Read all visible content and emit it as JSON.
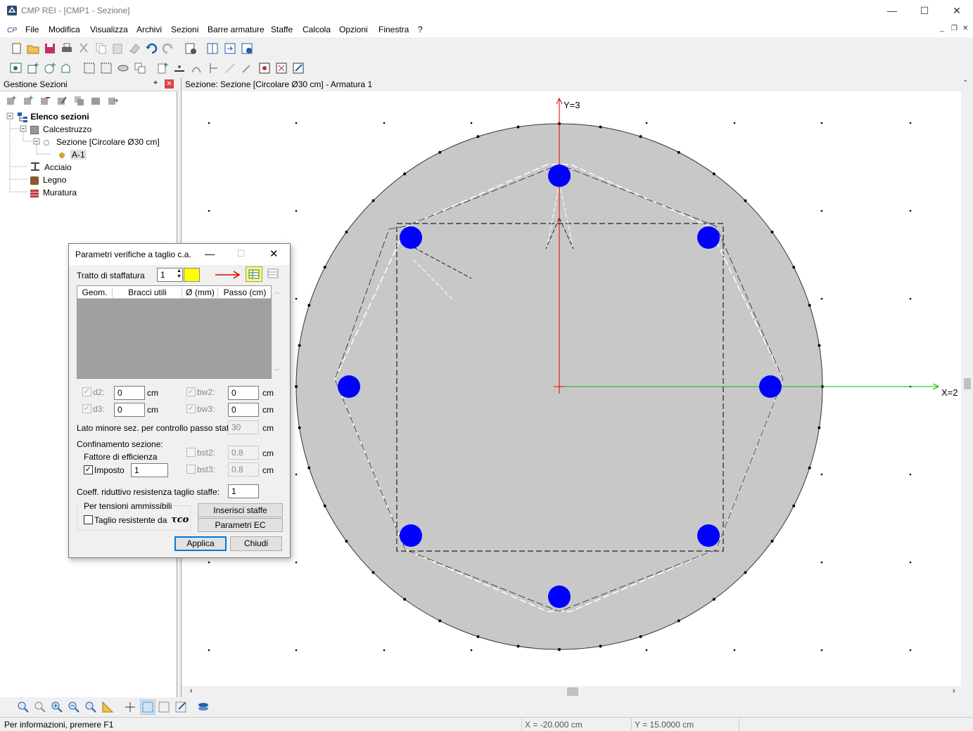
{
  "window": {
    "title": "CMP REI - [CMP1 - Sezione]",
    "minimize": "—",
    "maximize": "☐",
    "close": "✕"
  },
  "menu": [
    "File",
    "Modifica",
    "Visualizza",
    "Archivi",
    "Sezioni",
    "Barre armature",
    "Staffe",
    "Calcola",
    "Opzioni",
    "Finestra",
    "?"
  ],
  "panel": {
    "title": "Gestione Sezioni",
    "pin": "⌖",
    "close": "✕",
    "tree": {
      "root": "Elenco sezioni",
      "calcestruzzo": "Calcestruzzo",
      "sezione": "Sezione [Circolare Ø30 cm]",
      "armatura": "A-1",
      "acciaio": "Acciaio",
      "legno": "Legno",
      "muratura": "Muratura"
    }
  },
  "canvas": {
    "title": "Sezione: Sezione [Circolare Ø30 cm] - Armatura 1",
    "y_axis_label": "Y=3",
    "x_axis_label": "X=2"
  },
  "dialog": {
    "title": "Parametri verifiche a taglio c.a.",
    "tratto_label": "Tratto di staffatura",
    "tratto_value": "1",
    "table_headers": [
      "Geom.",
      "Bracci utili",
      "Ø (mm)",
      "Passo (cm)"
    ],
    "d2_label": "d2:",
    "d2_value": "0",
    "d3_label": "d3:",
    "d3_value": "0",
    "bw2_label": "bw2:",
    "bw2_value": "0",
    "bw3_label": "bw3:",
    "bw3_value": "0",
    "unit_cm": "cm",
    "lato_label": "Lato minore sez. per controllo passo staffe:",
    "lato_value": "30",
    "confinamento_label": "Confinamento sezione:",
    "fattore_label": "Fattore di efficienza",
    "imposto_label": "Imposto",
    "imposto_value": "1",
    "bst2_label": "bst2:",
    "bst2_value": "0.8",
    "bst3_label": "bst3:",
    "bst3_value": "0.8",
    "coeff_label": "Coeff. riduttivo resistenza taglio staffe:",
    "coeff_value": "1",
    "tensioni_label": "Per tensioni ammissibili",
    "taglio_label": "Taglio resistente da",
    "tau_symbol": "τco",
    "inserisci_btn": "Inserisci staffe",
    "parametri_btn": "Parametri EC",
    "applica_btn": "Applica",
    "chiudi_btn": "Chiudi",
    "check": "✓"
  },
  "status": {
    "info": "Per informazioni, premere F1",
    "x": "X = -20.000 cm",
    "y": "Y = 15.0000 cm"
  },
  "colors": {
    "section_fill": "#c8c8c8",
    "rebar": "#0000ff",
    "y_axis": "#e00000",
    "x_axis": "#00c000",
    "highlight": "#ffff00"
  }
}
